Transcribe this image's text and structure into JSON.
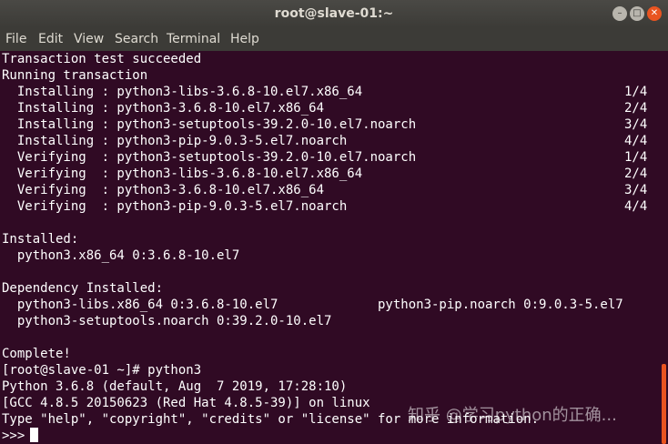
{
  "window": {
    "title": "root@slave-01:~",
    "minimize_glyph": "–",
    "maximize_glyph": "□",
    "close_glyph": "✕"
  },
  "menu": [
    "File",
    "Edit",
    "View",
    "Search",
    "Terminal",
    "Help"
  ],
  "terminal": {
    "lines": [
      "Transaction test succeeded",
      "Running transaction",
      "  Installing : python3-libs-3.6.8-10.el7.x86_64",
      "  Installing : python3-3.6.8-10.el7.x86_64",
      "  Installing : python3-setuptools-39.2.0-10.el7.noarch",
      "  Installing : python3-pip-9.0.3-5.el7.noarch",
      "  Verifying  : python3-setuptools-39.2.0-10.el7.noarch",
      "  Verifying  : python3-libs-3.6.8-10.el7.x86_64",
      "  Verifying  : python3-3.6.8-10.el7.x86_64",
      "  Verifying  : python3-pip-9.0.3-5.el7.noarch",
      "",
      "Installed:",
      "  python3.x86_64 0:3.6.8-10.el7",
      "",
      "Dependency Installed:",
      "  python3-libs.x86_64 0:3.6.8-10.el7",
      "  python3-setuptools.noarch 0:39.2.0-10.el7",
      "",
      "Complete!",
      "[root@slave-01 ~]# python3",
      "Python 3.6.8 (default, Aug  7 2019, 17:28:10)",
      "[GCC 4.8.5 20150623 (Red Hat 4.8.5-39)] on linux",
      "Type \"help\", \"copyright\", \"credits\" or \"license\" for more information.",
      ">>>"
    ],
    "counts": [
      "1/4",
      "2/4",
      "3/4",
      "4/4",
      "1/4",
      "2/4",
      "3/4",
      "4/4"
    ],
    "dependency_col2": "python3-pip.noarch 0:9.0.3-5.el7"
  },
  "watermark": "知乎 @学习python的正确..."
}
